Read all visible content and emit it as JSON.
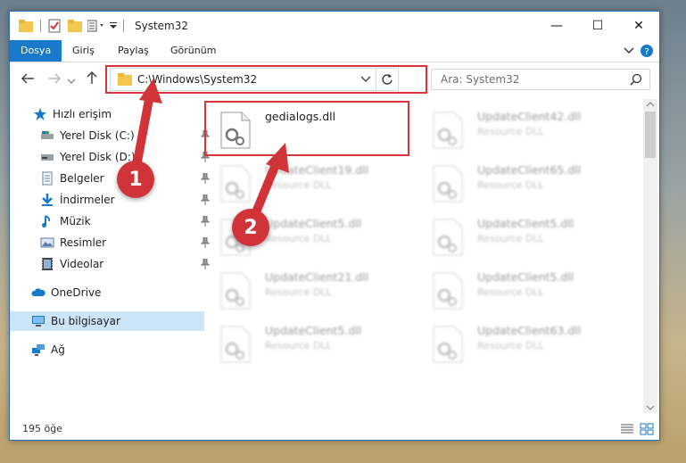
{
  "window": {
    "title": "System32",
    "minimize": "—",
    "maximize": "☐",
    "close": "✕"
  },
  "ribbon": {
    "tabs": [
      "Dosya",
      "Giriş",
      "Paylaş",
      "Görünüm"
    ]
  },
  "address": {
    "path": "C:\\Windows\\System32"
  },
  "search": {
    "placeholder": "Ara: System32"
  },
  "sidebar": {
    "items": [
      {
        "label": "Hızlı erişim",
        "icon": "star-icon"
      },
      {
        "label": "Yerel Disk (C:)",
        "icon": "drive-icon"
      },
      {
        "label": "Yerel Disk (D:)",
        "icon": "drive-icon"
      },
      {
        "label": "Belgeler",
        "icon": "document-icon"
      },
      {
        "label": "İndirmeler",
        "icon": "download-icon"
      },
      {
        "label": "Müzik",
        "icon": "music-icon"
      },
      {
        "label": "Resimler",
        "icon": "pictures-icon"
      },
      {
        "label": "Videolar",
        "icon": "video-icon"
      },
      {
        "label": "OneDrive",
        "icon": "cloud-icon"
      },
      {
        "label": "Bu bilgisayar",
        "icon": "computer-icon"
      },
      {
        "label": "Ağ",
        "icon": "network-icon"
      }
    ]
  },
  "files": [
    {
      "name": "gedialogs.dll",
      "type": ""
    },
    {
      "name": "UpdateClient42.dll",
      "type": "Resource DLL"
    },
    {
      "name": "UpdateClient19.dll",
      "type": "Resource DLL"
    },
    {
      "name": "UpdateClient65.dll",
      "type": "Resource DLL"
    },
    {
      "name": "UpdateClient5.dll",
      "type": "Resource DLL"
    },
    {
      "name": "UpdateClient5.dll",
      "type": "Resource DLL"
    },
    {
      "name": "UpdateClient21.dll",
      "type": "Resource DLL"
    },
    {
      "name": "UpdateClient5.dll",
      "type": "Resource DLL"
    },
    {
      "name": "UpdateClient5.dll",
      "type": "Resource DLL"
    },
    {
      "name": "UpdateClient63.dll",
      "type": "Resource DLL"
    }
  ],
  "status": {
    "count": "195 öğe"
  },
  "annotations": {
    "step1": "1",
    "step2": "2"
  },
  "colors": {
    "accent": "#1979ca",
    "highlight_box": "#d9343a",
    "badge": "#d13438"
  }
}
